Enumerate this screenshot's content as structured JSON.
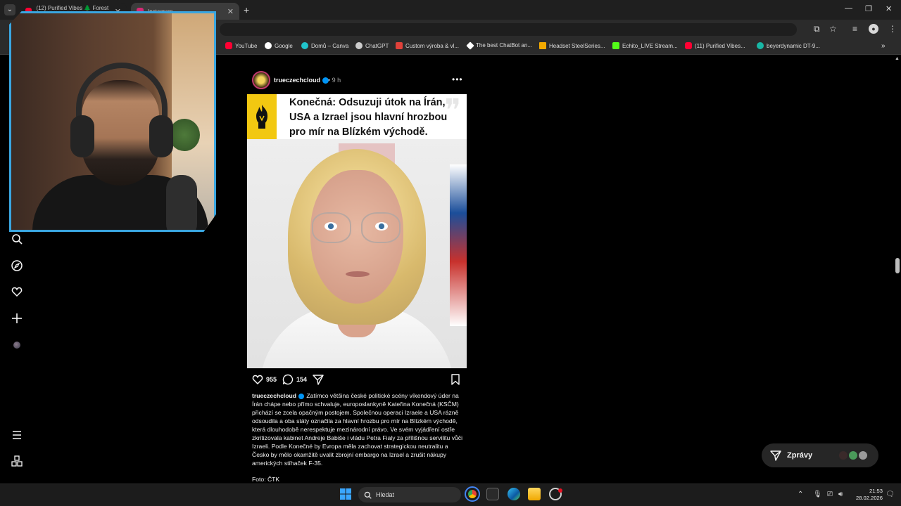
{
  "browser": {
    "tabs": [
      {
        "title": "(12) Purified Vibes 🌲 Forest ...",
        "active": false,
        "favicon_color": "#ff0033"
      },
      {
        "title": "Instagram",
        "active": true,
        "favicon_color": "#d62976"
      }
    ],
    "bookmarks": [
      {
        "label": "YouTube",
        "icon_color": "#ff0033"
      },
      {
        "label": "Google",
        "icon_color": "#ffffff"
      },
      {
        "label": "Domů – Canva",
        "icon_color": "#20c4cb"
      },
      {
        "label": "ChatGPT",
        "icon_color": "#cccccc"
      },
      {
        "label": "Custom výroba & vl...",
        "icon_color": "#e0413a"
      },
      {
        "label": "The best ChatBot an...",
        "icon_color": "#ffffff"
      },
      {
        "label": "Headset SteelSeries...",
        "icon_color": "#f2a900"
      },
      {
        "label": "Echito_LIVE Stream...",
        "icon_color": "#53fc18"
      },
      {
        "label": "(11) Purified Vibes...",
        "icon_color": "#ff0033"
      },
      {
        "label": "beyerdynamic DT-9...",
        "icon_color": "#18b7a5"
      }
    ]
  },
  "rail": {
    "icons": [
      "search-icon",
      "explore-icon",
      "heart-icon",
      "create-icon",
      "profile-avatar",
      "menu-icon",
      "apps-icon"
    ]
  },
  "post": {
    "username": "trueczechcloud",
    "time": "• 9 h",
    "image_headline": "Konečná: Odsuzuji útok na Írán, USA a Izrael jsou hlavní hrozbou pro mír na Blízkém východě.",
    "likes": "955",
    "comments": "154",
    "caption_user": "trueczechcloud",
    "caption_text": " Zatímco většina české politické scény víkendový úder na Írán chápe nebo přímo schvaluje, europoslankyně Kateřina Konečná (KSČM) přichází se zcela opačným postojem. Společnou operaci Izraele a USA rázně odsoudila a oba státy označila za hlavní hrozbu pro mír na Blízkém východě, která dlouhodobě nerespektuje mezinárodní právo. Ve svém vyjádření ostře zkritizovala kabinet Andreje Babiše i vládu Petra Fialy za přílišnou servilitu vůči Izraeli. Podle Konečné by Evropa měla zachovat strategickou neutralitu a Česko by mělo okamžitě uvalit zbrojní embargo na Izrael a zrušit nákupy amerických stíhaček F-35.",
    "photo_credit": "Foto: ČTK"
  },
  "messages": {
    "label": "Zprávy"
  },
  "taskbar": {
    "search_placeholder": "Hledat",
    "time": "21:53",
    "date": "28.02.2026"
  },
  "colors": {
    "accent": "#0095f6",
    "webcam_border": "#3aa6e0",
    "logo_yellow": "#f2c811"
  }
}
